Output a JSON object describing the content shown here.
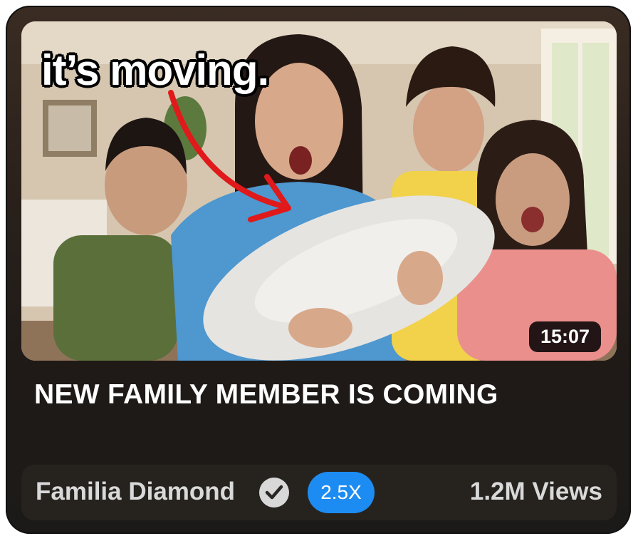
{
  "video": {
    "overlay_text": "it’s moving.",
    "duration": "15:07",
    "title": "NEW FAMILY MEMBER IS COMING"
  },
  "footer": {
    "channel_name": "Familia Diamond",
    "verified_icon": "check-circle-icon",
    "speed_badge": "2.5X",
    "views": "1.2M Views"
  },
  "colors": {
    "speed_badge_bg": "#1d8cf2",
    "card_bg": "#1f1a17",
    "arrow": "#e0191b"
  }
}
